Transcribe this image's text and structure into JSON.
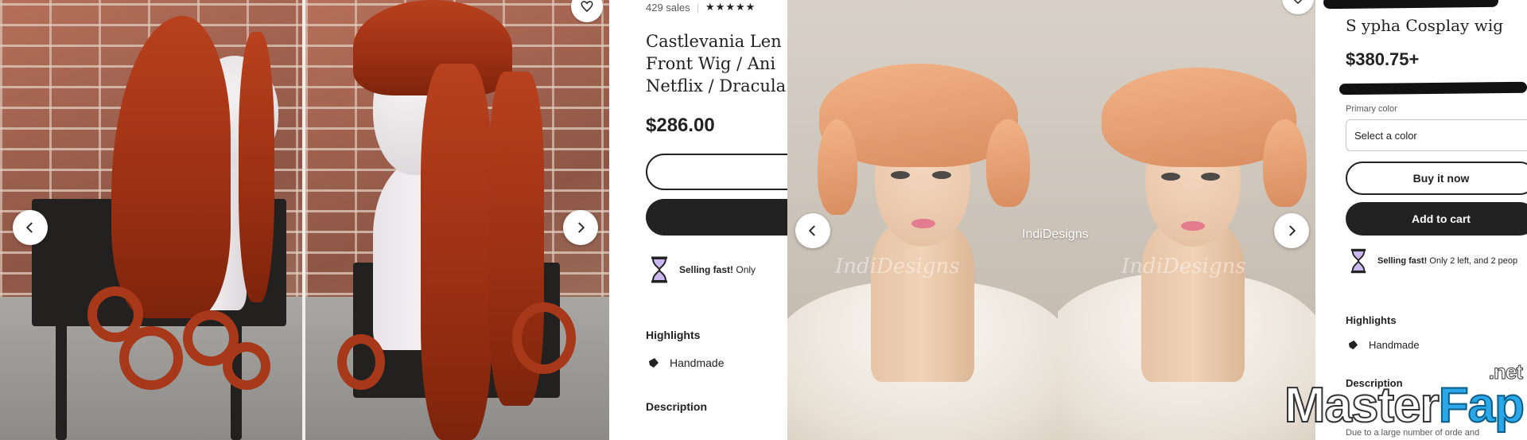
{
  "left_listing": {
    "sales_text": "429 sales",
    "stars": "★★★★★",
    "title_lines": [
      "Castlevania Len",
      "Front Wig / Ani",
      "Netflix / Dracula"
    ],
    "price": "$286.00",
    "buy_now_label": "",
    "add_to_cart_label": "",
    "selling_fast_label": "Selling fast!",
    "selling_fast_text": "Only",
    "highlights_heading": "Highlights",
    "handmade_label": "Handmade",
    "description_heading": "Description"
  },
  "right_listing": {
    "title": "S ypha Cosplay wig",
    "price": "$380.75+",
    "primary_color_label": "Primary color",
    "select_placeholder": "Select a color",
    "buy_now_label": "Buy it now",
    "add_to_cart_label": "Add to cart",
    "selling_fast_label": "Selling fast!",
    "selling_fast_text": "Only 2 left, and 2 peop",
    "highlights_heading": "Highlights",
    "handmade_label": "Handmade",
    "description_heading": "Description",
    "description_snippet": "Due to a large number of orde and",
    "photo_shop_label": "IndiDesigns",
    "photo_watermark": "IndiDesigns"
  },
  "site_logo": {
    "part_a": "Master",
    "part_b": "Fap",
    "suffix": ".net"
  },
  "icons": {
    "prev": "chevron-left-icon",
    "next": "chevron-right-icon",
    "favorite": "heart-icon",
    "hourglass": "hourglass-icon",
    "handmade": "hand-icon"
  },
  "colors": {
    "button_dark": "#222222",
    "logo_blue": "#2aa7e8"
  }
}
